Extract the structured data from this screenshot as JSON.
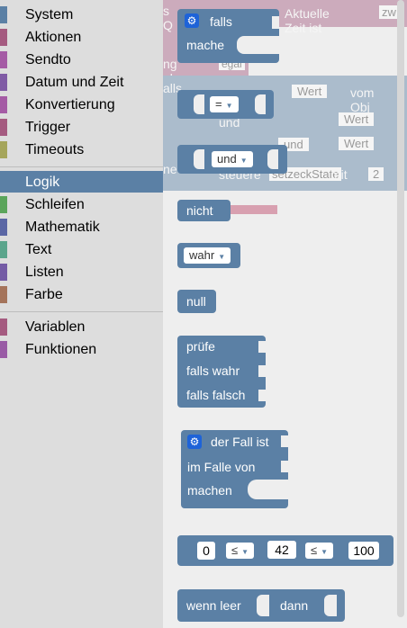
{
  "toolbox": {
    "categories": [
      {
        "label": "System",
        "color": "#5b80a5"
      },
      {
        "label": "Aktionen",
        "color": "#a55b80"
      },
      {
        "label": "Sendto",
        "color": "#a55ba5"
      },
      {
        "label": "Datum und Zeit",
        "color": "#805ba5"
      },
      {
        "label": "Konvertierung",
        "color": "#a55ba5"
      },
      {
        "label": "Trigger",
        "color": "#a55b80"
      },
      {
        "label": "Timeouts",
        "color": "#a5a55b"
      },
      {
        "label": "Logik",
        "color": "#5b80a5",
        "selected": true
      },
      {
        "label": "Schleifen",
        "color": "#5ba55b"
      },
      {
        "label": "Mathematik",
        "color": "#5b67a5"
      },
      {
        "label": "Text",
        "color": "#5ba58c"
      },
      {
        "label": "Listen",
        "color": "#745ba5"
      },
      {
        "label": "Farbe",
        "color": "#a5745b"
      },
      {
        "label": "Variablen",
        "color": "#a55b80"
      },
      {
        "label": "Funktionen",
        "color": "#995ba5"
      }
    ]
  },
  "background_workspace": {
    "aktuelle_zeit": "Aktuelle Zeit ist",
    "zw": "zw",
    "ng_egal": "ng ob",
    "egal": "egal",
    "alls": "alls",
    "wert1": "Wert",
    "vom_obj": "vom Obj",
    "und": "und",
    "wert2": "Wert",
    "wert3": "Wert",
    "und2": "und",
    "steuere": "steuere",
    "setzeckstate": "setzeckState",
    "mit": "mit",
    "two": "2",
    "ne": "ne",
    "s_q": "s Q"
  },
  "blocks": {
    "falls": {
      "falls": "falls",
      "mache": "mache"
    },
    "compare": {
      "op": "="
    },
    "logic_op": {
      "op": "und"
    },
    "negate": {
      "label": "nicht"
    },
    "boolean": {
      "value": "wahr"
    },
    "null": {
      "label": "null"
    },
    "ternary": {
      "pruefe": "prüfe",
      "falls_wahr": "falls wahr",
      "falls_falsch": "falls falsch"
    },
    "switch": {
      "der_fall_ist": "der Fall ist",
      "im_falle_von": "im Falle von",
      "machen": "machen"
    },
    "between": {
      "a": "0",
      "op1": "≤",
      "b": "42",
      "op2": "≤",
      "c": "100"
    },
    "ifnull": {
      "wenn_leer": "wenn leer",
      "dann": "dann"
    }
  }
}
